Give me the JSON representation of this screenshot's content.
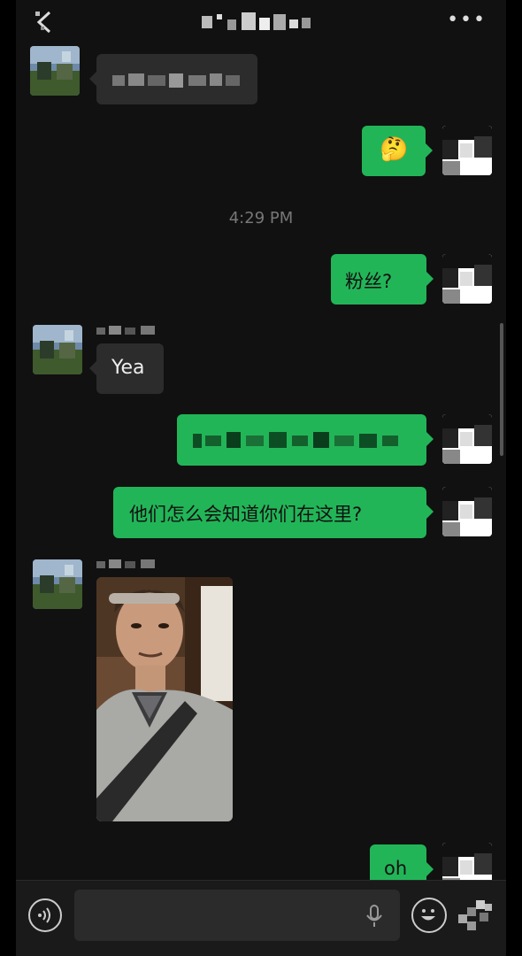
{
  "header": {
    "back_icon": "back-arrow-icon",
    "title_redacted": true,
    "more_label": "•••"
  },
  "messages": [
    {
      "side": "left",
      "type": "text",
      "redacted": true
    },
    {
      "side": "right",
      "type": "emoji",
      "emoji": "🤔"
    },
    {
      "type": "timestamp",
      "text": "4:29 PM"
    },
    {
      "side": "right",
      "type": "text",
      "text": "粉丝?"
    },
    {
      "side": "left",
      "type": "text",
      "text": "Yea"
    },
    {
      "side": "right",
      "type": "text",
      "redacted": true
    },
    {
      "side": "right",
      "type": "text",
      "text": "他们怎么会知道你们在这里?"
    },
    {
      "side": "left",
      "type": "image",
      "description": "selfie photo"
    },
    {
      "side": "right",
      "type": "text",
      "text": "oh"
    }
  ],
  "input_bar": {
    "voice_icon": "voice-mode-icon",
    "mic_icon": "microphone-icon",
    "emoji_icon": "emoji-icon",
    "plus_icon": "more-options-icon"
  },
  "colors": {
    "background": "#111111",
    "incoming_bubble": "#2c2c2c",
    "outgoing_bubble": "#22b558",
    "timestamp": "#777777"
  }
}
